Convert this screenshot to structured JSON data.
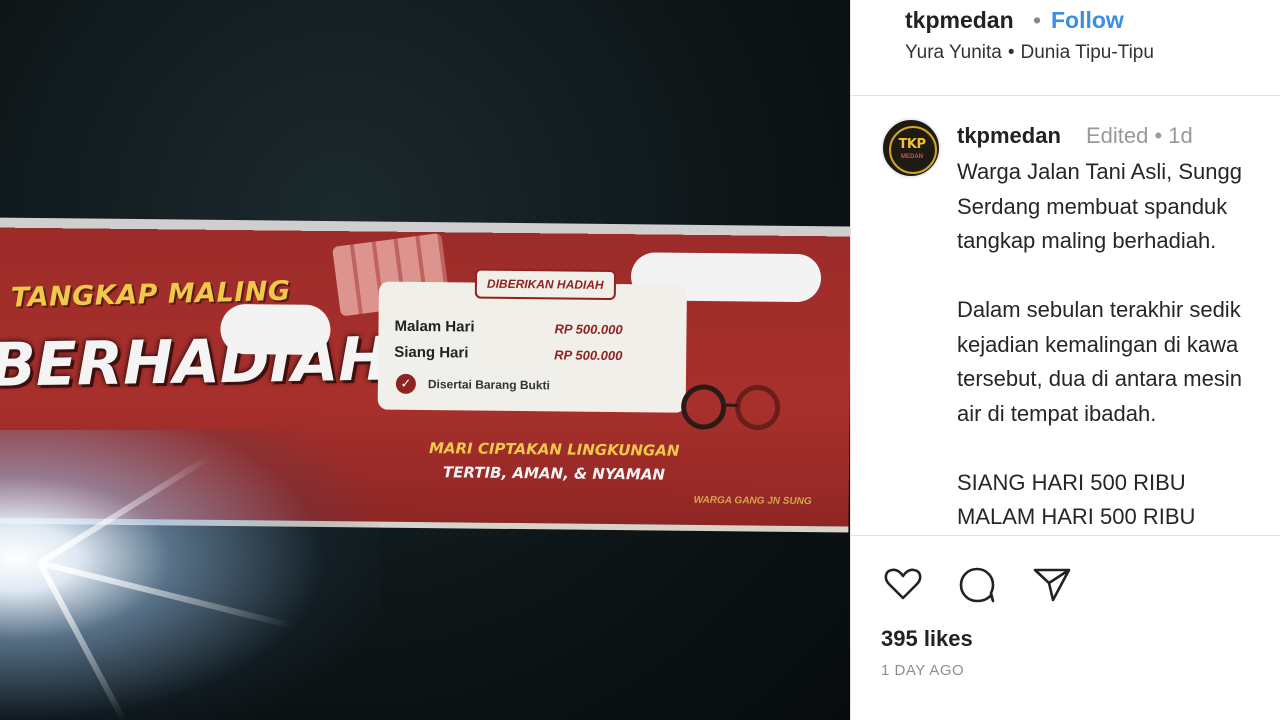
{
  "photo": {
    "banner": {
      "headline_top": "TANGKAP MALING",
      "headline_main": "BERHADIAH",
      "card_header": "DIBERIKAN HADIAH",
      "rows": [
        {
          "label": "Malam Hari",
          "value": "RP 500.000"
        },
        {
          "label": "Siang Hari",
          "value": "RP 500.000"
        }
      ],
      "card_note": "Disertai Barang Bukti",
      "slogan_line1": "MARI CIPTAKAN LINGKUNGAN",
      "slogan_line2": "TERTIB, AMAN, & NYAMAN",
      "footer": "WARGA GANG JN SUNG"
    }
  },
  "header": {
    "username": "tkpmedan",
    "separator": "•",
    "follow_label": "Follow",
    "sub_left": "Yura Yunita",
    "sub_sep": "•",
    "sub_right": "Dunia Tipu-Tipu"
  },
  "post": {
    "avatar_logo": "TKP",
    "avatar_sub": "MEDAN",
    "username": "tkpmedan",
    "meta": "Edited •  1d",
    "caption": {
      "line1": "Warga Jalan Tani Asli, Sungg",
      "line2": "Serdang membuat spanduk",
      "line3": "tangkap maling berhadiah.",
      "line4": "Dalam sebulan terakhir sedik",
      "line5": "kejadian kemalingan di kawa",
      "line6": "tersebut, dua di antara mesin",
      "line7": "air di tempat ibadah.",
      "line8": "SIANG HARI 500 RIBU",
      "line9": "MALAM HARI 500 RIBU"
    }
  },
  "actions": {
    "icons": [
      "heart-icon",
      "comment-icon",
      "share-icon"
    ],
    "likes": "395 likes",
    "time_ago": "1 DAY AGO"
  },
  "colors": {
    "follow": "#3a8ee6",
    "banner_red": "#a8302c",
    "banner_yellow": "#f0c94a"
  }
}
